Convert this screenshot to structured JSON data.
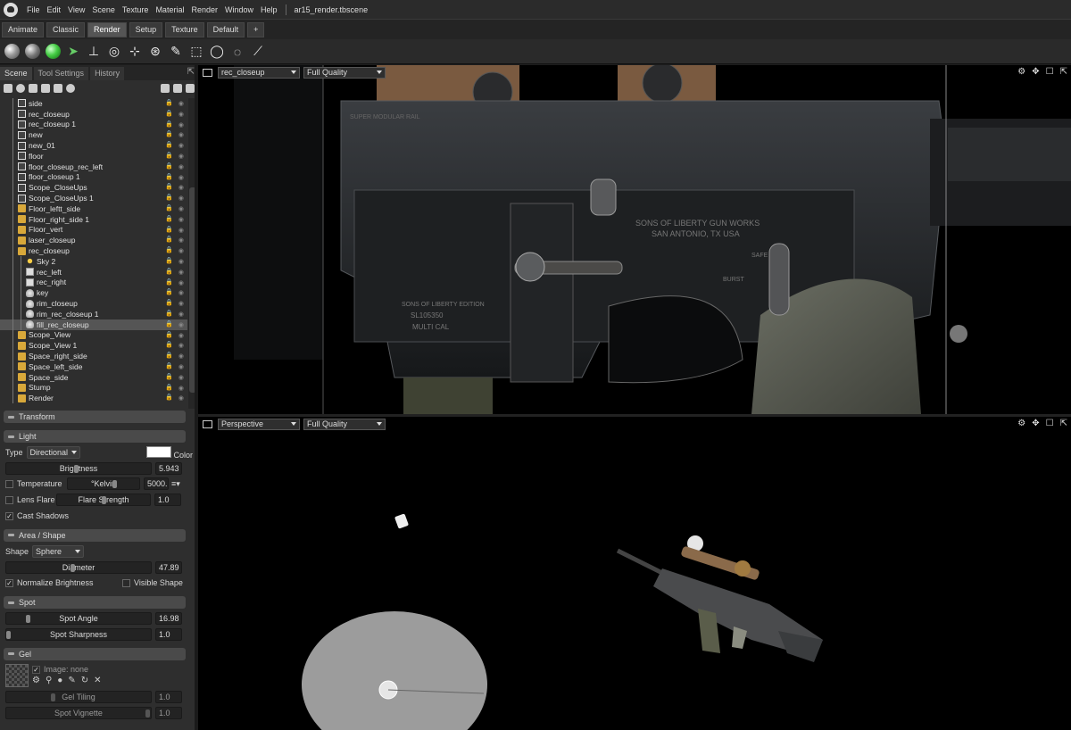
{
  "menu": {
    "items": [
      "File",
      "Edit",
      "View",
      "Scene",
      "Texture",
      "Material",
      "Render",
      "Window",
      "Help"
    ],
    "title": "ar15_render.tbscene"
  },
  "modes": {
    "tabs": [
      "Animate",
      "Classic",
      "Render",
      "Setup",
      "Texture",
      "Default",
      "+"
    ]
  },
  "panel": {
    "tabs": [
      "Scene",
      "Tool Settings",
      "History"
    ]
  },
  "tree": [
    {
      "label": "side",
      "icon": "cam",
      "lock": "red",
      "depth": 1
    },
    {
      "label": "rec_closeup",
      "icon": "cam",
      "lock": "red",
      "depth": 1
    },
    {
      "label": "rec_closeup 1",
      "icon": "cam",
      "lock": "red",
      "depth": 1
    },
    {
      "label": "new",
      "icon": "cam",
      "lock": "red",
      "depth": 1
    },
    {
      "label": "new_01",
      "icon": "cam",
      "lock": "gray",
      "depth": 1
    },
    {
      "label": "floor",
      "icon": "cam",
      "lock": "red",
      "depth": 1
    },
    {
      "label": "floor_closeup_rec_left",
      "icon": "cam",
      "lock": "red",
      "depth": 1
    },
    {
      "label": "floor_closeup 1",
      "icon": "cam",
      "lock": "red",
      "depth": 1
    },
    {
      "label": "Scope_CloseUps",
      "icon": "cam",
      "lock": "red",
      "depth": 1
    },
    {
      "label": "Scope_CloseUps 1",
      "icon": "cam",
      "lock": "red",
      "depth": 1
    },
    {
      "label": "Floor_leftt_side",
      "icon": "folder",
      "lock": "red",
      "depth": 1
    },
    {
      "label": "Floor_right_side 1",
      "icon": "folder",
      "lock": "red",
      "depth": 1
    },
    {
      "label": "Floor_vert",
      "icon": "folder",
      "lock": "red",
      "depth": 1
    },
    {
      "label": "laser_closeup",
      "icon": "folder",
      "lock": "gray",
      "depth": 1
    },
    {
      "label": "rec_closeup",
      "icon": "folder",
      "lock": "gray",
      "depth": 1
    },
    {
      "label": "Sky 2",
      "icon": "sun",
      "lock": "gray",
      "depth": 2
    },
    {
      "label": "rec_left",
      "icon": "tex",
      "lock": "gray",
      "depth": 2
    },
    {
      "label": "rec_right",
      "icon": "tex",
      "lock": "gray",
      "depth": 2
    },
    {
      "label": "key",
      "icon": "light",
      "lock": "gray",
      "depth": 2
    },
    {
      "label": "rim_closeup",
      "icon": "light",
      "lock": "gray",
      "depth": 2
    },
    {
      "label": "rim_rec_closeup 1",
      "icon": "light",
      "lock": "gray",
      "depth": 2
    },
    {
      "label": "fill_rec_closeup",
      "icon": "light",
      "lock": "gray",
      "depth": 2,
      "selected": true
    },
    {
      "label": "Scope_View",
      "icon": "folder",
      "lock": "red",
      "depth": 1
    },
    {
      "label": "Scope_View 1",
      "icon": "folder",
      "lock": "red",
      "depth": 1
    },
    {
      "label": "Space_right_side",
      "icon": "folder",
      "lock": "red",
      "depth": 1
    },
    {
      "label": "Space_left_side",
      "icon": "folder",
      "lock": "red",
      "depth": 1
    },
    {
      "label": "Space_side",
      "icon": "folder",
      "lock": "red",
      "depth": 1
    },
    {
      "label": "Stump",
      "icon": "folder",
      "lock": "gray",
      "depth": 1
    },
    {
      "label": "Render",
      "icon": "folder",
      "lock": "gray",
      "depth": 1
    }
  ],
  "props": {
    "transform": "Transform",
    "light": {
      "title": "Light",
      "type_label": "Type",
      "type_value": "Directional",
      "color_label": "Color",
      "brightness_label": "Brightness",
      "brightness_value": "5.943",
      "temperature_label": "Temperature",
      "kelvin_label": "°Kelvin",
      "kelvin_value": "5000.",
      "lens_flare_label": "Lens Flare",
      "flare_strength_label": "Flare Strength",
      "flare_strength_value": "1.0",
      "cast_shadows_label": "Cast Shadows"
    },
    "area": {
      "title": "Area / Shape",
      "shape_label": "Shape",
      "shape_value": "Sphere",
      "diameter_label": "Diameter",
      "diameter_value": "47.89",
      "normalize_label": "Normalize Brightness",
      "visible_shape_label": "Visible Shape"
    },
    "spot": {
      "title": "Spot",
      "angle_label": "Spot Angle",
      "angle_value": "16.98",
      "sharpness_label": "Spot Sharpness",
      "sharpness_value": "1.0"
    },
    "gel": {
      "title": "Gel",
      "image_label": "Image: none",
      "tiling_label": "Gel Tiling",
      "tiling_value": "1.0",
      "vignette_label": "Spot Vignette",
      "vignette_value": "1.0"
    }
  },
  "viewport_top": {
    "camera": "rec_closeup",
    "quality": "Full Quality"
  },
  "viewport_bottom": {
    "camera": "Perspective",
    "quality": "Full Quality"
  },
  "receiver": {
    "line1": "SUPER MODULAR RAIL",
    "line2": "SONS OF LIBERTY GUN WORKS",
    "line3": "SAN ANTONIO, TX USA",
    "line4": "SAFE",
    "line5": "BURST",
    "line6": "SONS OF LIBERTY EDITION",
    "line7": "SL105350",
    "line8": "MULTI CAL"
  }
}
